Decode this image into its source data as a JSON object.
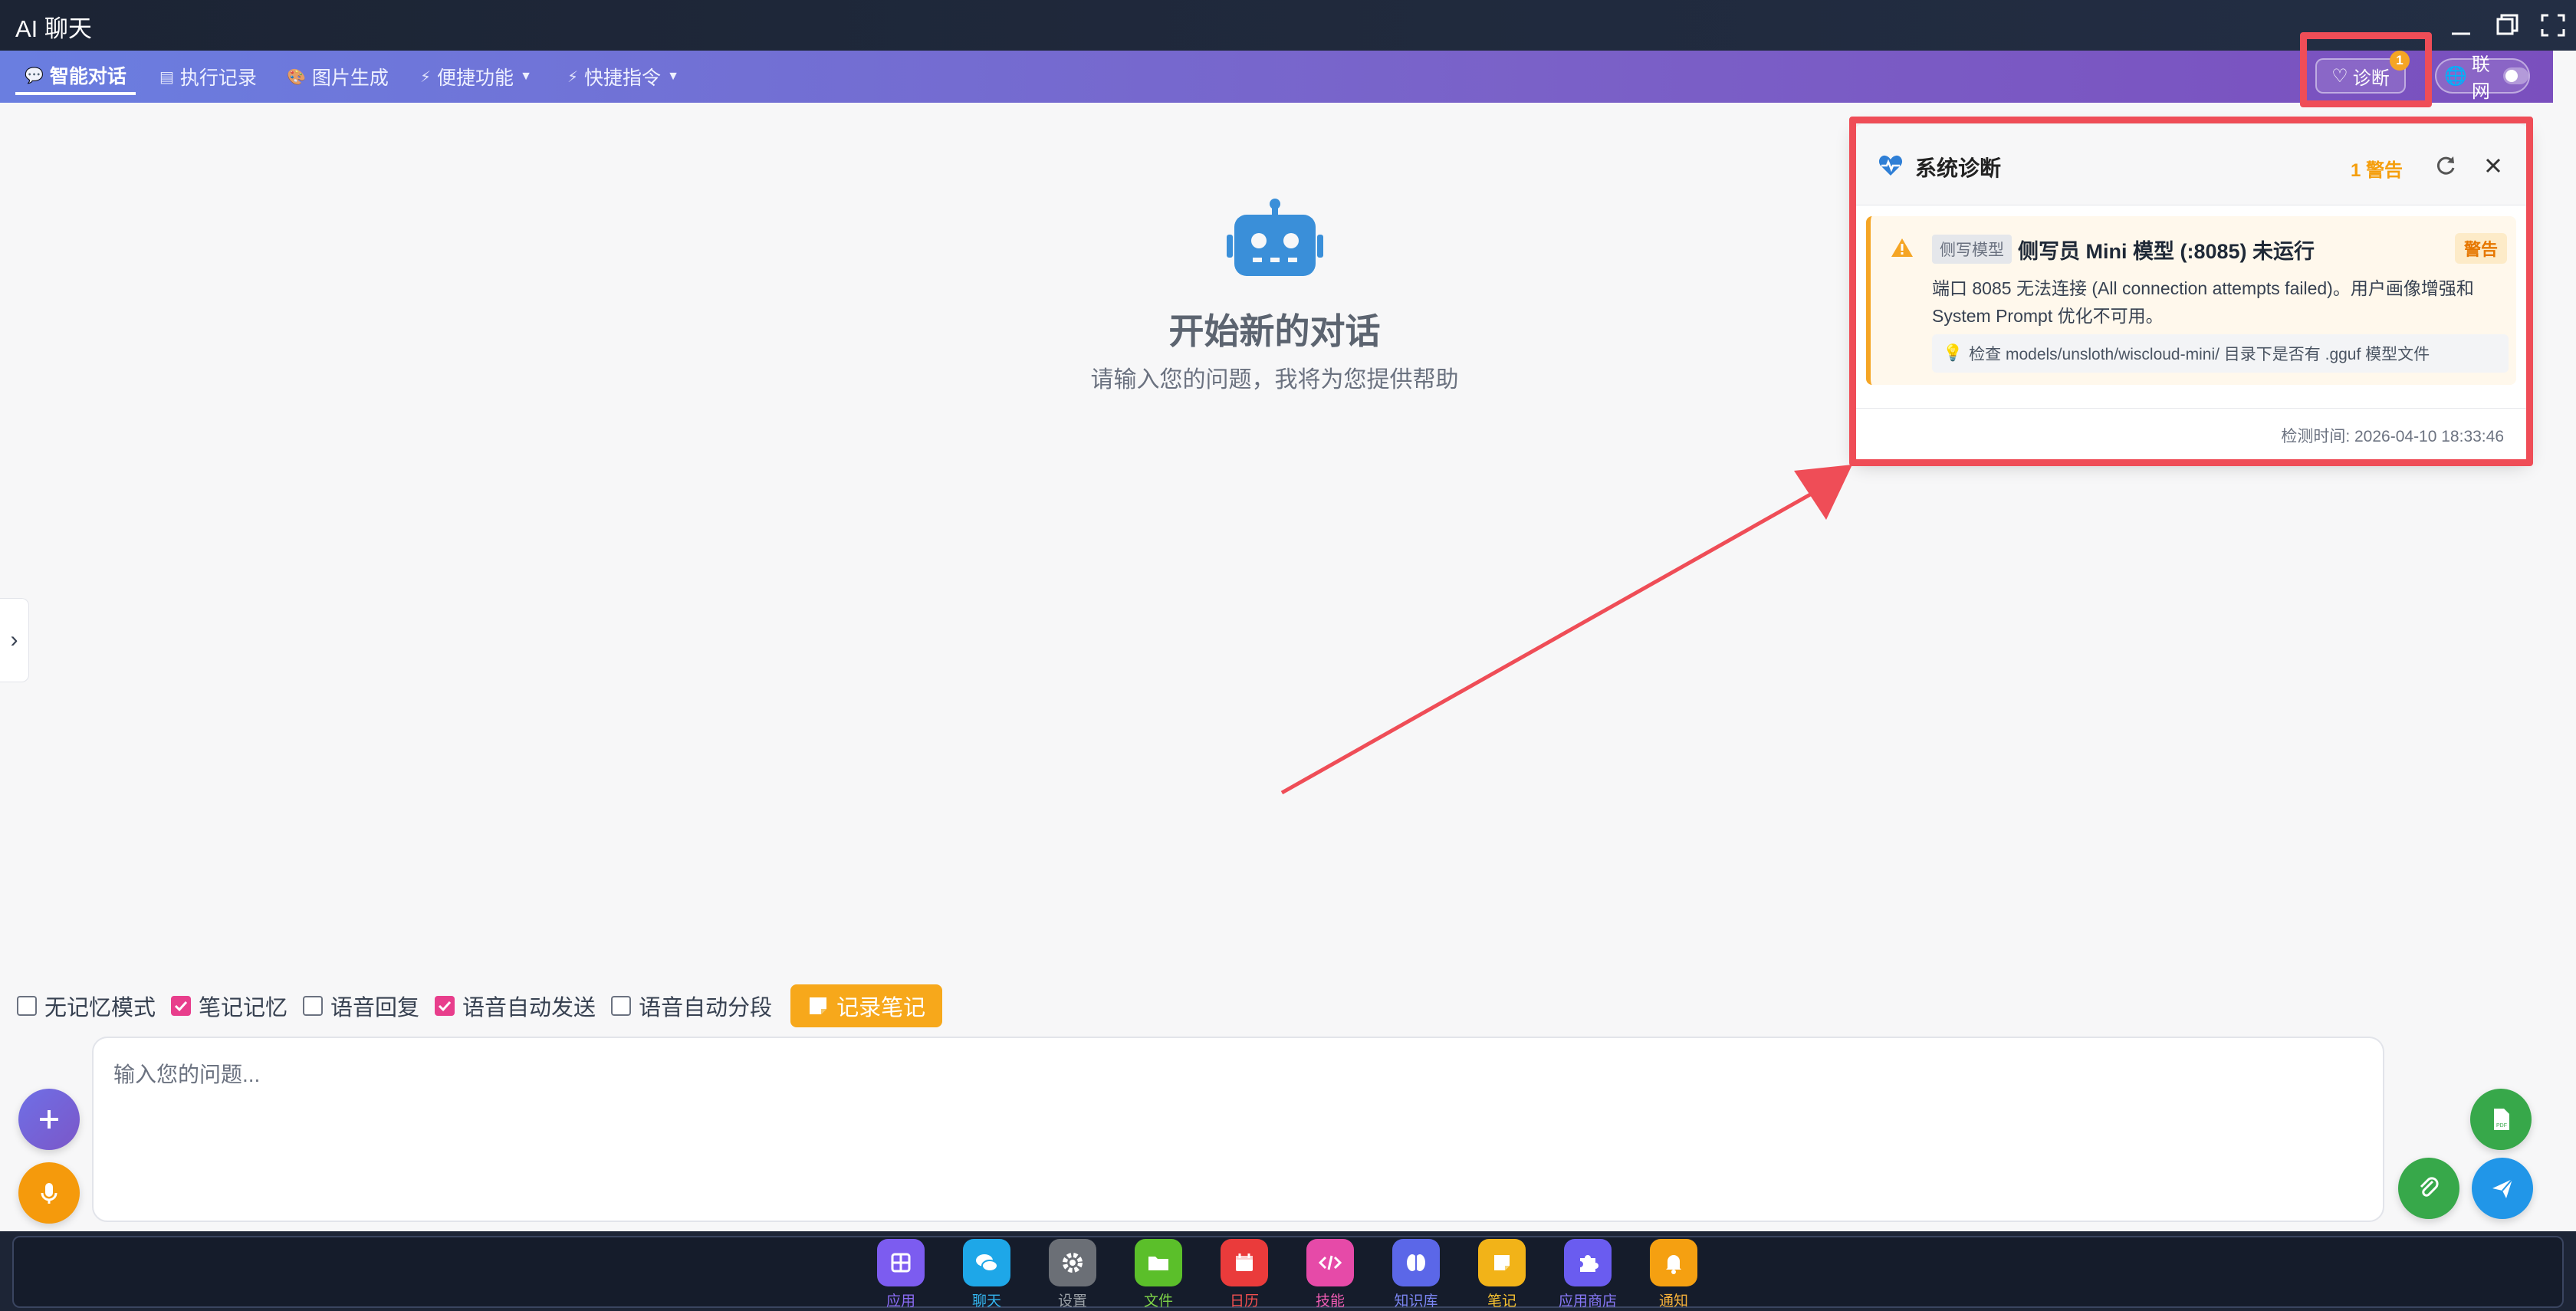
{
  "window": {
    "title": "AI 聊天"
  },
  "nav": {
    "tabs": [
      {
        "label": "智能对话",
        "icon": "chat-bubble-icon",
        "active": true
      },
      {
        "label": "执行记录",
        "icon": "list-icon"
      },
      {
        "label": "图片生成",
        "icon": "palette-icon"
      },
      {
        "label": "便捷功能",
        "icon": "bolt-icon",
        "dropdown": true
      },
      {
        "label": "快捷指令",
        "icon": "bolt-icon",
        "dropdown": true
      }
    ],
    "diagnose_label": "诊断",
    "diagnose_badge": "1",
    "network_label": "联网",
    "network_on": false
  },
  "empty_state": {
    "title": "开始新的对话",
    "subtitle": "请输入您的问题，我将为您提供帮助"
  },
  "diagnostics": {
    "title": "系统诊断",
    "summary": "1 警告",
    "alert": {
      "tag": "侧写模型",
      "title": "侧写员 Mini 模型 (:8085) 未运行",
      "level": "警告",
      "description": "端口 8085 无法连接 (All connection attempts failed)。用户画像增强和 System Prompt 优化不可用。",
      "hint": "检查 models/unsloth/wiscloud-mini/ 目录下是否有 .gguf 模型文件"
    },
    "checked_at": "检测时间: 2026-04-10 18:33:46"
  },
  "options": [
    {
      "label": "无记忆模式",
      "checked": false
    },
    {
      "label": "笔记记忆",
      "checked": true
    },
    {
      "label": "语音回复",
      "checked": false
    },
    {
      "label": "语音自动发送",
      "checked": true
    },
    {
      "label": "语音自动分段",
      "checked": false
    }
  ],
  "note_button": "记录笔记",
  "input": {
    "placeholder": "输入您的问题..."
  },
  "dock": [
    {
      "label": "应用",
      "icon": "apps-grid-icon",
      "color": "#7c5cf0",
      "label_color": "#8b6cf5"
    },
    {
      "label": "聊天",
      "icon": "chat-icon",
      "color": "#1ea7e8",
      "label_color": "#34b6f0"
    },
    {
      "label": "设置",
      "icon": "gear-icon",
      "color": "#6b6f76",
      "label_color": "#9aa0a6"
    },
    {
      "label": "文件",
      "icon": "folder-icon",
      "color": "#5bbf2a",
      "label_color": "#7ed348"
    },
    {
      "label": "日历",
      "icon": "calendar-icon",
      "color": "#ea3b3b",
      "label_color": "#f04f4f"
    },
    {
      "label": "技能",
      "icon": "code-icon",
      "color": "#e64aa8",
      "label_color": "#f05cb4"
    },
    {
      "label": "知识库",
      "icon": "brain-icon",
      "color": "#5b67e8",
      "label_color": "#7a85f0"
    },
    {
      "label": "笔记",
      "icon": "note-icon",
      "color": "#f2b318",
      "label_color": "#f5c030"
    },
    {
      "label": "应用商店",
      "icon": "puzzle-icon",
      "color": "#6a5cf0",
      "label_color": "#8677f5"
    },
    {
      "label": "通知",
      "icon": "bell-icon",
      "color": "#f5a011",
      "label_color": "#f7b13a"
    }
  ]
}
